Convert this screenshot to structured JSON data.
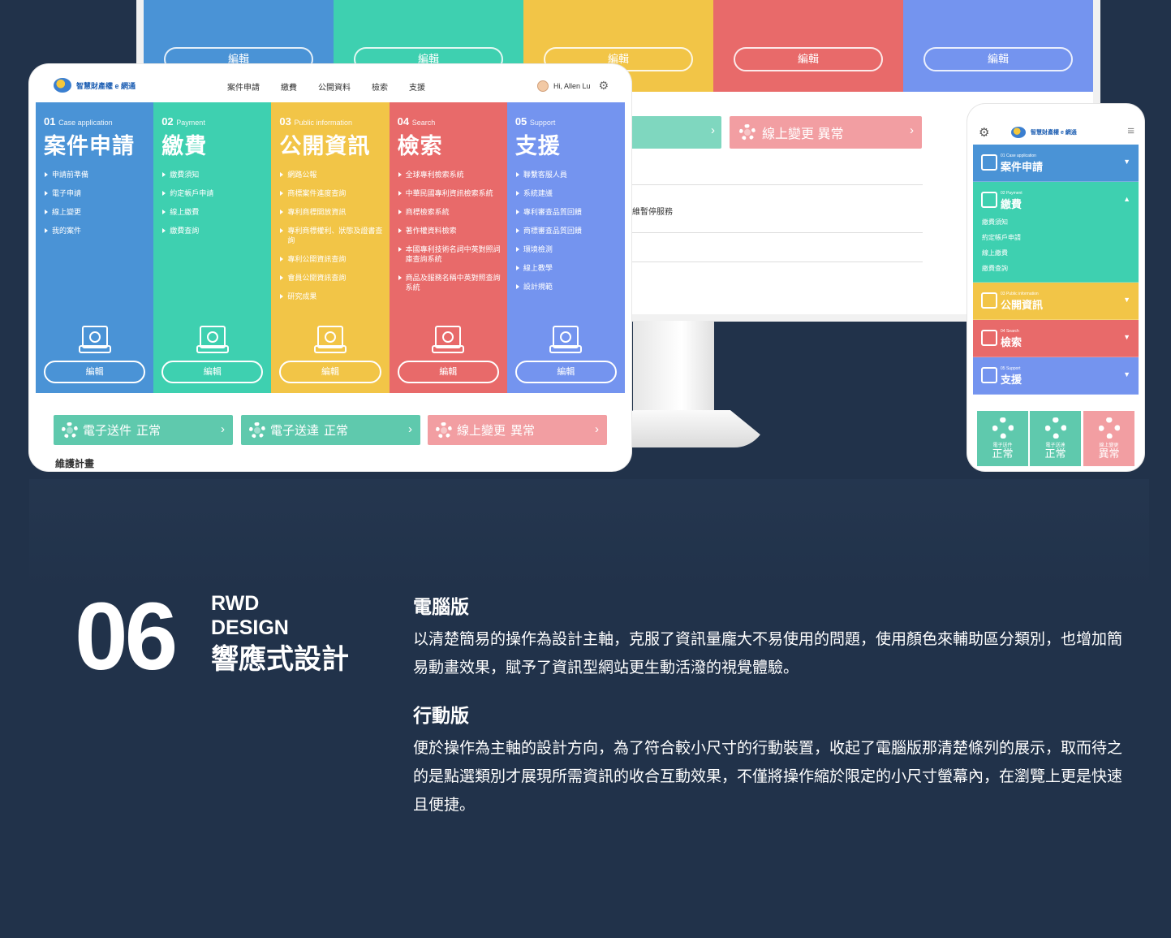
{
  "colors": {
    "blue": "#4a93d6",
    "green": "#3ed0b0",
    "yellow": "#f2c547",
    "red": "#e86a6a",
    "purple": "#7494ef",
    "status_green": "#5fc9ad",
    "status_red": "#f29ea2",
    "bg": "#21324a"
  },
  "monitor": {
    "col_button": "編輯",
    "status_right": "線上變更 異常",
    "notice": "維暫停服務"
  },
  "logo": {
    "text": "智慧財產權 e 網通"
  },
  "nav": [
    "案件申請",
    "繳費",
    "公開資料",
    "檢索",
    "支援"
  ],
  "user": {
    "greeting": "Hi, Allen Lu"
  },
  "categories": [
    {
      "num": "01",
      "en": "Case application",
      "title": "案件申請",
      "color": "#4a93d6",
      "icon": "form-mail-icon",
      "items": [
        "申請前準備",
        "電子申請",
        "線上變更",
        "我的案件"
      ]
    },
    {
      "num": "02",
      "en": "Payment",
      "title": "繳費",
      "color": "#3ed0b0",
      "icon": "payment-icon",
      "items": [
        "繳費須知",
        "約定帳戶申請",
        "線上繳費",
        "繳費查詢"
      ]
    },
    {
      "num": "03",
      "en": "Public information",
      "title": "公開資訊",
      "color": "#f2c547",
      "icon": "laptop-lock-icon",
      "items": [
        "網路公報",
        "商標案件進度查詢",
        "專利商標開放資訊",
        "專利商標權利、狀態及證書查詢",
        "專利公開資訊查詢",
        "會員公開資訊查詢",
        "研究成果"
      ]
    },
    {
      "num": "04",
      "en": "Search",
      "title": "檢索",
      "color": "#e86a6a",
      "icon": "search-document-icon",
      "items": [
        "全球專利檢索系統",
        "中華民國專利資訊檢索系統",
        "商標檢索系統",
        "著作權資料檢索",
        "本國專利技術名詞中英對照詞庫查詢系統",
        "商品及服務名稱中英對照查詢系統"
      ]
    },
    {
      "num": "05",
      "en": "Support",
      "title": "支援",
      "color": "#7494ef",
      "icon": "handshake-icon",
      "items": [
        "聯繫客服人員",
        "系統建議",
        "專利審查品質回饋",
        "商標審查品質回饋",
        "環境檢測",
        "線上教學",
        "設計規範"
      ]
    }
  ],
  "edit_label": "編輯",
  "status": [
    {
      "name": "電子送件",
      "state": "正常",
      "color": "#5fc9ad"
    },
    {
      "name": "電子送達",
      "state": "正常",
      "color": "#5fc9ad"
    },
    {
      "name": "線上變更",
      "state": "異常",
      "color": "#f29ea2"
    }
  ],
  "maintenance": "維護計畫",
  "phone": {
    "sub_items": [
      "繳費須知",
      "約定帳戶申請",
      "線上繳費",
      "繳費查詢"
    ]
  },
  "section": {
    "number": "06",
    "en1": "RWD",
    "en2": "DESIGN",
    "zh": "響應式設計",
    "desktop_title": "電腦版",
    "desktop_text": "以清楚簡易的操作為設計主軸，克服了資訊量龐大不易使用的問題，使用顏色來輔助區分類別，也增加簡易動畫效果，賦予了資訊型網站更生動活潑的視覺體驗。",
    "mobile_title": "行動版",
    "mobile_text": "便於操作為主軸的設計方向，為了符合較小尺寸的行動裝置，收起了電腦版那清楚條列的展示，取而待之的是點選類別才展現所需資訊的收合互動效果，不僅將操作縮於限定的小尺寸螢幕內，在瀏覽上更是快速且便捷。"
  }
}
